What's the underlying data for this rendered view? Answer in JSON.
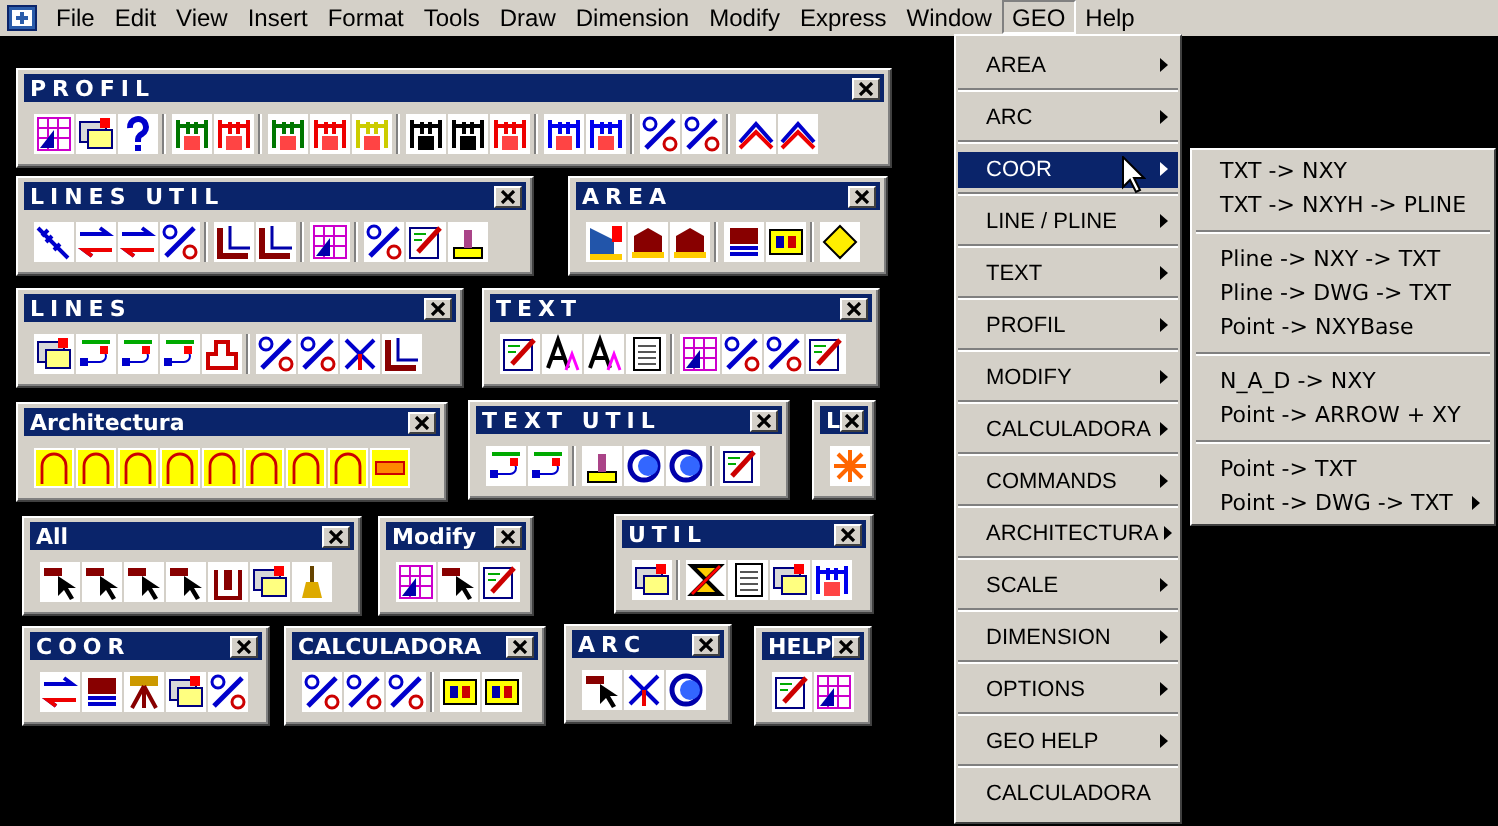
{
  "menu_bar": [
    {
      "label": "File",
      "selected": false
    },
    {
      "label": "Edit",
      "selected": false
    },
    {
      "label": "View",
      "selected": false
    },
    {
      "label": "Insert",
      "selected": false
    },
    {
      "label": "Format",
      "selected": false
    },
    {
      "label": "Tools",
      "selected": false
    },
    {
      "label": "Draw",
      "selected": false
    },
    {
      "label": "Dimension",
      "selected": false
    },
    {
      "label": "Modify",
      "selected": false
    },
    {
      "label": "Express",
      "selected": false
    },
    {
      "label": "Window",
      "selected": false
    },
    {
      "label": "GEO",
      "selected": true
    },
    {
      "label": "Help",
      "selected": false
    }
  ],
  "toolbars": [
    {
      "title": "PROFIL",
      "spaced": true,
      "buttons": [
        {
          "kind": "tool"
        },
        {
          "kind": "tool"
        },
        {
          "kind": "tool"
        },
        {
          "kind": "separator"
        },
        {
          "kind": "tool"
        },
        {
          "kind": "tool"
        },
        {
          "kind": "separator"
        },
        {
          "kind": "tool"
        },
        {
          "kind": "tool"
        },
        {
          "kind": "tool"
        },
        {
          "kind": "separator"
        },
        {
          "kind": "tool"
        },
        {
          "kind": "tool"
        },
        {
          "kind": "tool"
        },
        {
          "kind": "separator"
        },
        {
          "kind": "tool"
        },
        {
          "kind": "tool"
        },
        {
          "kind": "separator"
        },
        {
          "kind": "tool"
        },
        {
          "kind": "tool"
        },
        {
          "kind": "separator"
        },
        {
          "kind": "tool"
        },
        {
          "kind": "tool"
        }
      ]
    },
    {
      "title": "LINES UTIL",
      "spaced": true,
      "buttons": [
        {
          "kind": "tool"
        },
        {
          "kind": "tool"
        },
        {
          "kind": "tool"
        },
        {
          "kind": "tool"
        },
        {
          "kind": "separator"
        },
        {
          "kind": "tool"
        },
        {
          "kind": "tool"
        },
        {
          "kind": "separator"
        },
        {
          "kind": "tool"
        },
        {
          "kind": "separator"
        },
        {
          "kind": "tool"
        },
        {
          "kind": "tool"
        },
        {
          "kind": "tool"
        }
      ]
    },
    {
      "title": "AREA",
      "spaced": true,
      "buttons": [
        {
          "kind": "tool"
        },
        {
          "kind": "tool"
        },
        {
          "kind": "tool"
        },
        {
          "kind": "separator"
        },
        {
          "kind": "tool"
        },
        {
          "kind": "tool"
        },
        {
          "kind": "separator"
        },
        {
          "kind": "tool"
        }
      ]
    },
    {
      "title": "LINES",
      "spaced": true,
      "buttons": [
        {
          "kind": "tool"
        },
        {
          "kind": "tool"
        },
        {
          "kind": "tool"
        },
        {
          "kind": "tool"
        },
        {
          "kind": "tool"
        },
        {
          "kind": "separator"
        },
        {
          "kind": "tool"
        },
        {
          "kind": "tool"
        },
        {
          "kind": "tool"
        },
        {
          "kind": "tool"
        }
      ]
    },
    {
      "title": "TEXT",
      "spaced": true,
      "buttons": [
        {
          "kind": "tool"
        },
        {
          "kind": "tool"
        },
        {
          "kind": "tool"
        },
        {
          "kind": "tool"
        },
        {
          "kind": "separator"
        },
        {
          "kind": "tool"
        },
        {
          "kind": "tool"
        },
        {
          "kind": "tool"
        },
        {
          "kind": "tool"
        }
      ]
    },
    {
      "title": "Architectura",
      "spaced": false,
      "buttons": [
        {
          "kind": "tool"
        },
        {
          "kind": "tool"
        },
        {
          "kind": "tool"
        },
        {
          "kind": "tool"
        },
        {
          "kind": "tool"
        },
        {
          "kind": "tool"
        },
        {
          "kind": "tool"
        },
        {
          "kind": "tool"
        },
        {
          "kind": "tool"
        }
      ]
    },
    {
      "title": "TEXT UTIL",
      "spaced": true,
      "buttons": [
        {
          "kind": "tool"
        },
        {
          "kind": "tool"
        },
        {
          "kind": "separator"
        },
        {
          "kind": "tool"
        },
        {
          "kind": "tool"
        },
        {
          "kind": "tool"
        },
        {
          "kind": "separator"
        },
        {
          "kind": "tool"
        }
      ]
    },
    {
      "title": "L",
      "spaced": false,
      "buttons": [
        {
          "kind": "tool"
        }
      ]
    },
    {
      "title": "All",
      "spaced": false,
      "buttons": [
        {
          "kind": "tool"
        },
        {
          "kind": "tool"
        },
        {
          "kind": "tool"
        },
        {
          "kind": "tool"
        },
        {
          "kind": "tool"
        },
        {
          "kind": "tool"
        },
        {
          "kind": "tool"
        }
      ]
    },
    {
      "title": "Modify",
      "spaced": false,
      "buttons": [
        {
          "kind": "tool"
        },
        {
          "kind": "tool"
        },
        {
          "kind": "tool"
        }
      ]
    },
    {
      "title": "UTIL",
      "spaced": true,
      "buttons": [
        {
          "kind": "tool"
        },
        {
          "kind": "separator"
        },
        {
          "kind": "tool"
        },
        {
          "kind": "tool"
        },
        {
          "kind": "tool"
        },
        {
          "kind": "tool"
        }
      ]
    },
    {
      "title": "COOR",
      "spaced": true,
      "buttons": [
        {
          "kind": "tool"
        },
        {
          "kind": "tool"
        },
        {
          "kind": "tool"
        },
        {
          "kind": "tool"
        },
        {
          "kind": "tool"
        }
      ]
    },
    {
      "title": "CALCULADORA",
      "spaced": false,
      "buttons": [
        {
          "kind": "tool"
        },
        {
          "kind": "tool"
        },
        {
          "kind": "tool"
        },
        {
          "kind": "separator"
        },
        {
          "kind": "tool"
        },
        {
          "kind": "tool"
        }
      ]
    },
    {
      "title": "ARC",
      "spaced": true,
      "buttons": [
        {
          "kind": "tool"
        },
        {
          "kind": "tool"
        },
        {
          "kind": "tool"
        }
      ]
    },
    {
      "title": "HELP",
      "spaced": false,
      "buttons": [
        {
          "kind": "tool"
        },
        {
          "kind": "tool"
        }
      ]
    }
  ],
  "geo_menu": {
    "items": [
      {
        "label": "AREA",
        "submenu": true,
        "selected": false
      },
      {
        "label": "ARC",
        "submenu": true,
        "selected": false
      },
      {
        "label": "COOR",
        "submenu": true,
        "selected": true
      },
      {
        "label": "LINE / PLINE",
        "submenu": true,
        "selected": false
      },
      {
        "label": "TEXT",
        "submenu": true,
        "selected": false
      },
      {
        "label": "PROFIL",
        "submenu": true,
        "selected": false
      },
      {
        "label": "MODIFY",
        "submenu": true,
        "selected": false
      },
      {
        "label": "CALCULADORA",
        "submenu": true,
        "selected": false
      },
      {
        "label": "COMMANDS",
        "submenu": true,
        "selected": false
      },
      {
        "label": "ARCHITECTURA",
        "submenu": true,
        "selected": false
      },
      {
        "label": "SCALE",
        "submenu": true,
        "selected": false
      },
      {
        "label": "DIMENSION",
        "submenu": true,
        "selected": false
      },
      {
        "label": "OPTIONS",
        "submenu": true,
        "selected": false
      },
      {
        "label": "GEO HELP",
        "submenu": true,
        "selected": false
      },
      {
        "label": "CALCULADORA",
        "submenu": false,
        "selected": false
      }
    ]
  },
  "coor_submenu": {
    "groups": [
      [
        {
          "label": "TXT -> NXY",
          "submenu": false
        },
        {
          "label": "TXT -> NXYH -> PLINE",
          "submenu": false
        }
      ],
      [
        {
          "label": "Pline -> NXY -> TXT",
          "submenu": false
        },
        {
          "label": "Pline -> DWG -> TXT",
          "submenu": false
        },
        {
          "label": "Point -> NXYBase",
          "submenu": false
        }
      ],
      [
        {
          "label": "N_A_D -> NXY",
          "submenu": false
        },
        {
          "label": "Point -> ARROW + XY",
          "submenu": false
        }
      ],
      [
        {
          "label": "Point -> TXT",
          "submenu": false
        },
        {
          "label": "Point -> DWG -> TXT",
          "submenu": true
        }
      ]
    ]
  }
}
